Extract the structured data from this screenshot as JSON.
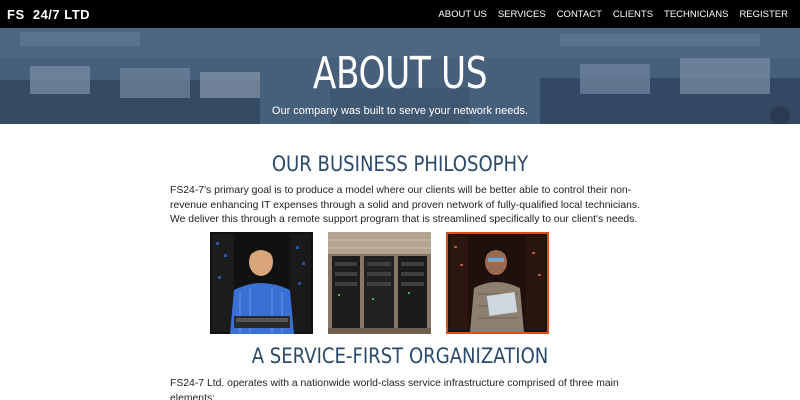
{
  "navbar": {
    "brand": "FS  24/7 LTD",
    "links": [
      "ABOUT US",
      "SERVICES",
      "CONTACT",
      "CLIENTS",
      "TECHNICIANS",
      "REGISTER"
    ]
  },
  "hero": {
    "title": "ABOUT US",
    "subtitle": "Our company was built to serve your network needs."
  },
  "philosophy": {
    "title": "OUR BUSINESS PHILOSOPHY",
    "lines": [
      "FS24-7's primary goal is to produce a model where our clients will be better able to control their non-",
      "revenue enhancing IT expenses through a solid and proven network of fully-qualified local technicians.",
      "We deliver this through a remote support program that is streamlined specifically to our client's needs."
    ]
  },
  "service": {
    "title": "A SERVICE-FIRST ORGANIZATION",
    "lines": [
      "FS24-7 Ltd. operates with a nationwide world-class service infrastructure comprised of three main",
      "elements:"
    ]
  },
  "colors": {
    "navbar_bg": "#000000",
    "heading": "#2a4a6b",
    "hero_tint": "#4b5f78",
    "photo_accent_border": "#d8501e"
  }
}
